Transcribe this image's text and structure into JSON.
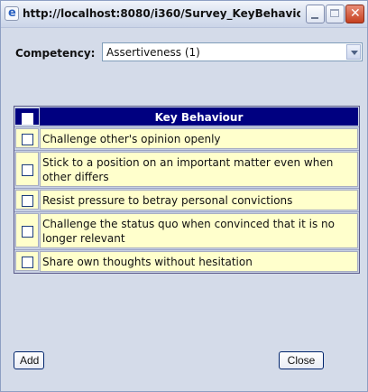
{
  "window": {
    "title": "http://localhost:8080/i360/Survey_KeyBehavio...",
    "close_glyph": "✕"
  },
  "form": {
    "competency_label": "Competency:",
    "competency_value": "Assertiveness (1)"
  },
  "table": {
    "header": "Key Behaviour",
    "rows": [
      "Challenge other's opinion openly",
      "Stick to a position on an important matter even when other differs",
      "Resist pressure to betray personal convictions",
      "Challenge the status quo when convinced that it is no longer relevant",
      "Share own thoughts without hesitation"
    ]
  },
  "buttons": {
    "add": "Add",
    "close": "Close"
  }
}
